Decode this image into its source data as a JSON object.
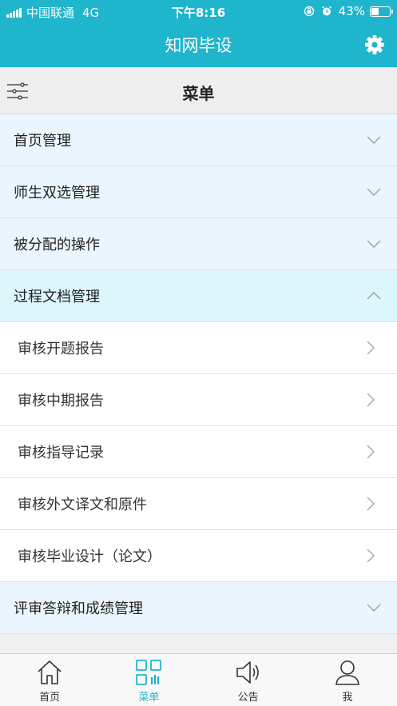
{
  "status_bar": {
    "carrier": "中国联通",
    "network": "4G",
    "time": "下午8:16",
    "battery": "43%",
    "battery_level": 0.43
  },
  "header": {
    "title": "知网毕设",
    "settings_icon": "gear-icon"
  },
  "menu_header": {
    "title": "菜单",
    "filter_icon": "sliders-icon"
  },
  "menu": {
    "sections": [
      {
        "label": "首页管理",
        "expanded": false
      },
      {
        "label": "师生双选管理",
        "expanded": false
      },
      {
        "label": "被分配的操作",
        "expanded": false
      },
      {
        "label": "过程文档管理",
        "expanded": true,
        "items": [
          "审核开题报告",
          "审核中期报告",
          "审核指导记录",
          "审核外文译文和原件",
          "审核毕业设计（论文）"
        ]
      },
      {
        "label": "评审答辩和成绩管理",
        "expanded": false
      }
    ]
  },
  "tab_bar": {
    "tabs": [
      {
        "label": "首页",
        "icon": "home-icon",
        "active": false
      },
      {
        "label": "菜单",
        "icon": "menu-grid-icon",
        "active": true
      },
      {
        "label": "公告",
        "icon": "speaker-icon",
        "active": false
      },
      {
        "label": "我",
        "icon": "user-icon",
        "active": false
      }
    ]
  },
  "colors": {
    "accent": "#1fb5cc",
    "section_bg": "#eaf5fd",
    "open_section_bg": "#dcf6fb"
  }
}
